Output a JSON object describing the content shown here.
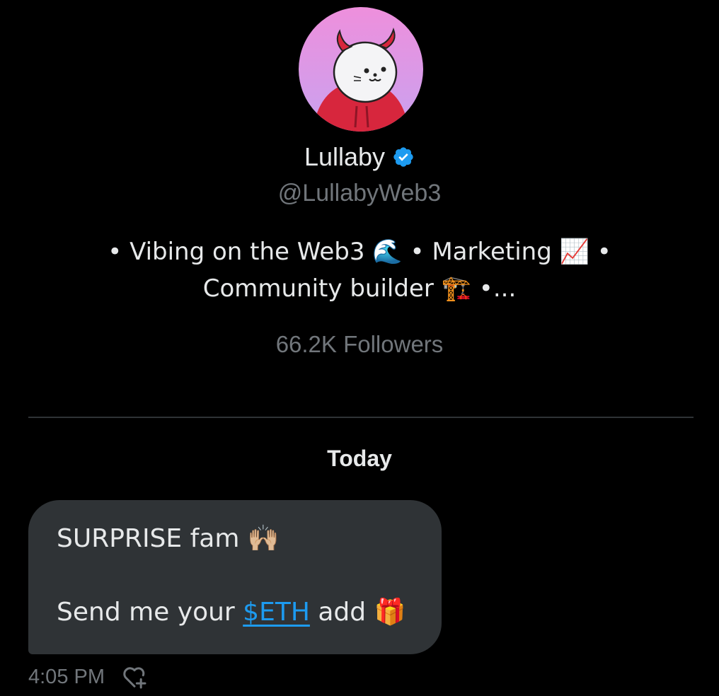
{
  "profile": {
    "display_name": "Lullaby",
    "handle": "@LullabyWeb3",
    "verified_icon": "verified-badge-icon",
    "bio_line1": "• Vibing on the Web3 🌊 • Marketing 📈 •",
    "bio_line2": "Community builder 🏗️ •...",
    "followers": "66.2K Followers"
  },
  "conversation": {
    "date_separator": "Today",
    "messages": [
      {
        "line1": "SURPRISE fam 🙌🏼",
        "line2_prefix": "Send me your ",
        "line2_cashtag": "$ETH",
        "line2_suffix": " add 🎁",
        "time": "4:05 PM",
        "reaction_icon": "add-reaction-heart-icon"
      }
    ]
  },
  "colors": {
    "background": "#000000",
    "primary_text": "#e7e9ea",
    "secondary_text": "#71767b",
    "bubble": "#2f3336",
    "accent": "#1d9bf0",
    "avatar_bg_top": "#ee8fdc",
    "avatar_bg_bottom": "#c9a2f0",
    "hoodie": "#d7263d"
  }
}
